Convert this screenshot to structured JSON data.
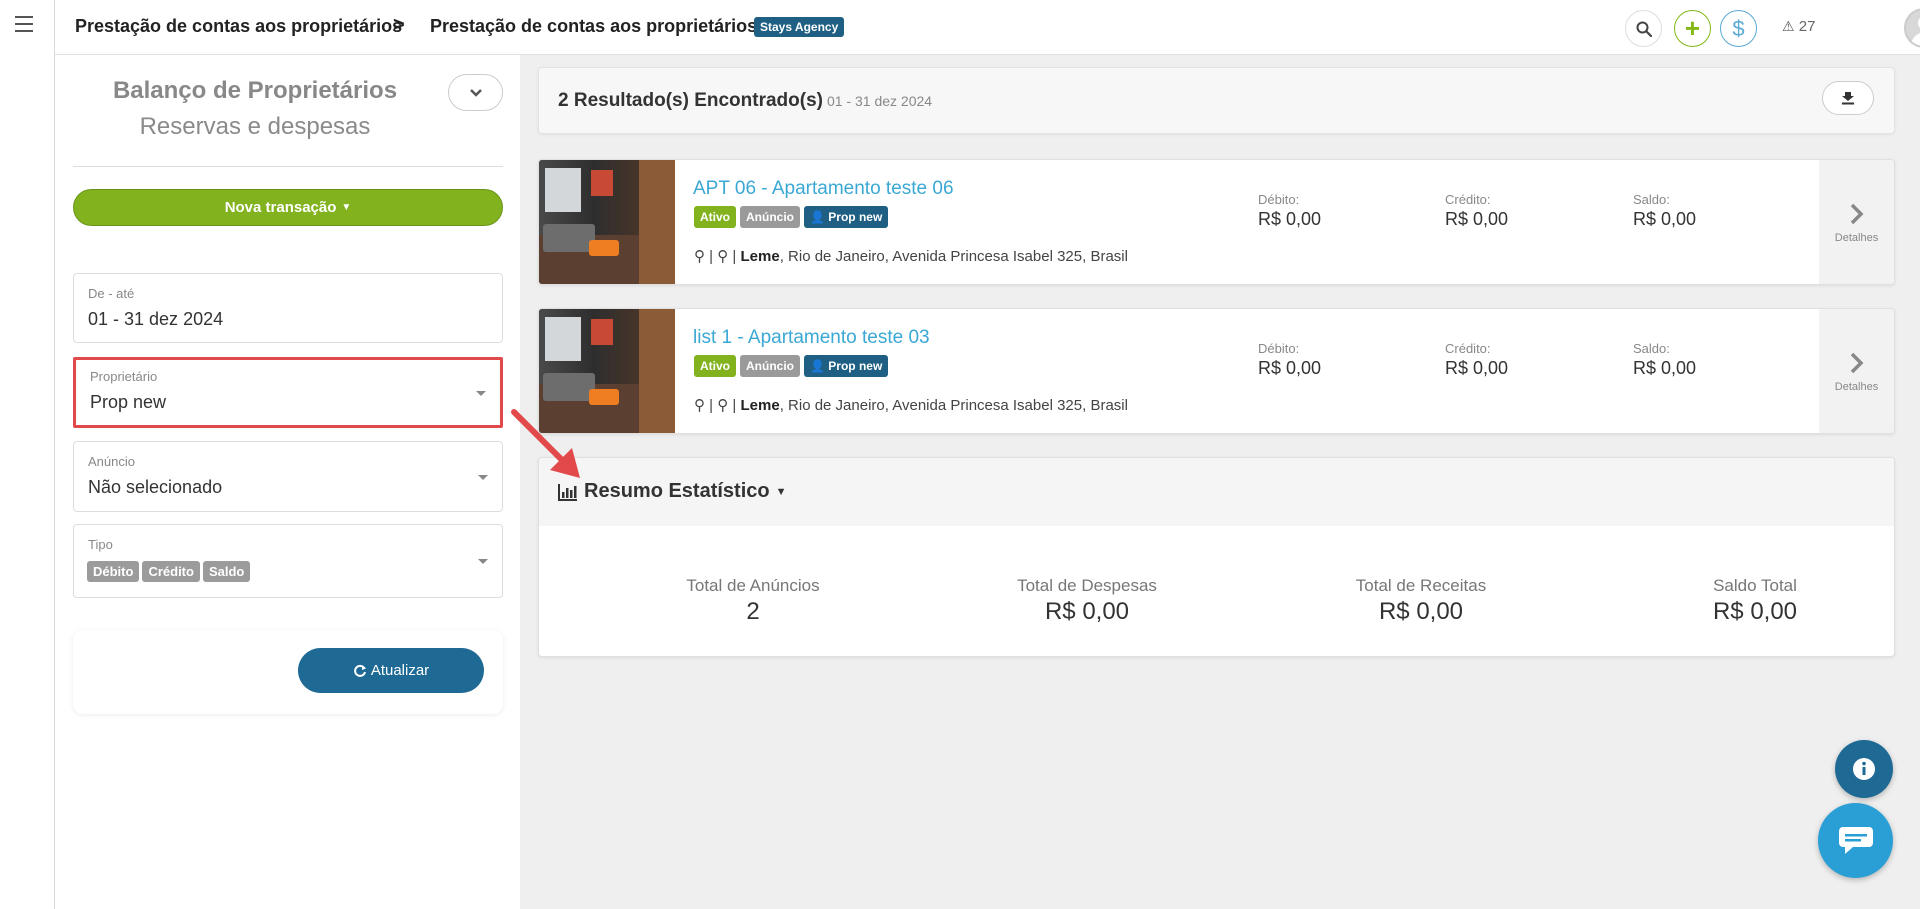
{
  "topbar": {
    "breadcrumb_1": "Prestação de contas aos proprietários",
    "breadcrumb_sep": ">",
    "breadcrumb_2": "Prestação de contas aos proprietários",
    "agency_badge": "Stays Agency",
    "alerts_count": "27"
  },
  "sidebar": {
    "title": "Balanço de Proprietários",
    "subtitle": "Reservas e despesas",
    "new_transaction_label": "Nova transação",
    "fields": {
      "date_range": {
        "label": "De - até",
        "value": "01 - 31 dez 2024"
      },
      "owner": {
        "label": "Proprietário",
        "value": "Prop new"
      },
      "listing": {
        "label": "Anúncio",
        "value": "Não selecionado"
      },
      "type": {
        "label": "Tipo",
        "options": [
          "Débito",
          "Crédito",
          "Saldo"
        ]
      }
    },
    "update_label": "Atualizar"
  },
  "results": {
    "title": "2 Resultado(s) Encontrado(s)",
    "range": "01 - 31 dez 2024"
  },
  "listings": [
    {
      "title": "APT 06 - Apartamento teste 06",
      "badges": [
        "Ativo",
        "Anúncio",
        "Prop new"
      ],
      "address_sep": "|",
      "address_bold": "Leme",
      "address_rest": ", Rio de Janeiro, Avenida Princesa Isabel 325, Brasil",
      "debit_label": "Débito:",
      "debit": "R$ 0,00",
      "credit_label": "Crédito:",
      "credit": "R$ 0,00",
      "balance_label": "Saldo:",
      "balance": "R$ 0,00",
      "details_label": "Detalhes"
    },
    {
      "title": "list 1 - Apartamento teste 03",
      "badges": [
        "Ativo",
        "Anúncio",
        "Prop new"
      ],
      "address_sep": "|",
      "address_bold": "Leme",
      "address_rest": ", Rio de Janeiro, Avenida Princesa Isabel 325, Brasil",
      "debit_label": "Débito:",
      "debit": "R$ 0,00",
      "credit_label": "Crédito:",
      "credit": "R$ 0,00",
      "balance_label": "Saldo:",
      "balance": "R$ 0,00",
      "details_label": "Detalhes"
    }
  ],
  "summary": {
    "title": "Resumo Estatístico",
    "stats": [
      {
        "label": "Total de Anúncios",
        "value": "2"
      },
      {
        "label": "Total de Despesas",
        "value": "R$ 0,00"
      },
      {
        "label": "Total de Receitas",
        "value": "R$ 0,00"
      },
      {
        "label": "Saldo Total",
        "value": "R$ 0,00"
      }
    ]
  },
  "colors": {
    "accent_green": "#82b31f",
    "accent_blue": "#1e6a95",
    "link_blue": "#3aa8d5",
    "highlight_red": "#e2494a"
  }
}
